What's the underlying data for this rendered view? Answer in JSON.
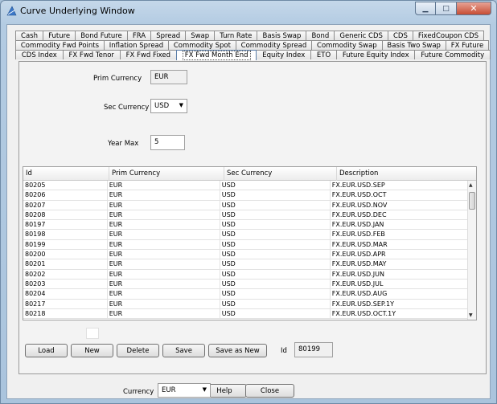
{
  "window": {
    "title": "Curve Underlying Window"
  },
  "tabs": {
    "row1": [
      "Cash",
      "Future",
      "Bond Future",
      "FRA",
      "Spread",
      "Swap",
      "Turn Rate",
      "Basis Swap",
      "Bond",
      "Generic CDS",
      "CDS",
      "FixedCoupon CDS"
    ],
    "row2": [
      "Commodity Fwd Points",
      "Inflation Spread",
      "Commodity Spot",
      "Commodity Spread",
      "Commodity Swap",
      "Basis Two Swap",
      "FX Future"
    ],
    "row3": [
      "CDS Index",
      "FX Fwd Tenor",
      "FX Fwd Fixed",
      "FX Fwd Month End",
      "Equity Index",
      "ETO",
      "Future Equity Index",
      "Future Commodity"
    ],
    "active": "FX Fwd Month End"
  },
  "form": {
    "prim_currency_label": "Prim Currency",
    "prim_currency_value": "EUR",
    "sec_currency_label": "Sec Currency",
    "sec_currency_value": "USD",
    "year_max_label": "Year Max",
    "year_max_value": "5"
  },
  "table": {
    "columns": [
      "Id",
      "Prim Currency",
      "Sec Currency",
      "Description"
    ],
    "rows": [
      [
        "80205",
        "EUR",
        "USD",
        "FX.EUR.USD.SEP"
      ],
      [
        "80206",
        "EUR",
        "USD",
        "FX.EUR.USD.OCT"
      ],
      [
        "80207",
        "EUR",
        "USD",
        "FX.EUR.USD.NOV"
      ],
      [
        "80208",
        "EUR",
        "USD",
        "FX.EUR.USD.DEC"
      ],
      [
        "80197",
        "EUR",
        "USD",
        "FX.EUR.USD.JAN"
      ],
      [
        "80198",
        "EUR",
        "USD",
        "FX.EUR.USD.FEB"
      ],
      [
        "80199",
        "EUR",
        "USD",
        "FX.EUR.USD.MAR"
      ],
      [
        "80200",
        "EUR",
        "USD",
        "FX.EUR.USD.APR"
      ],
      [
        "80201",
        "EUR",
        "USD",
        "FX.EUR.USD.MAY"
      ],
      [
        "80202",
        "EUR",
        "USD",
        "FX.EUR.USD.JUN"
      ],
      [
        "80203",
        "EUR",
        "USD",
        "FX.EUR.USD.JUL"
      ],
      [
        "80204",
        "EUR",
        "USD",
        "FX.EUR.USD.AUG"
      ],
      [
        "80217",
        "EUR",
        "USD",
        "FX.EUR.USD.SEP.1Y"
      ],
      [
        "80218",
        "EUR",
        "USD",
        "FX.EUR.USD.OCT.1Y"
      ]
    ]
  },
  "buttons": {
    "load": "Load",
    "new": "New",
    "delete": "Delete",
    "save": "Save",
    "save_as_new": "Save as New",
    "id_label": "Id",
    "id_value": "80199"
  },
  "footer": {
    "currency_label": "Currency",
    "currency_value": "EUR",
    "help": "Help",
    "close": "Close"
  }
}
